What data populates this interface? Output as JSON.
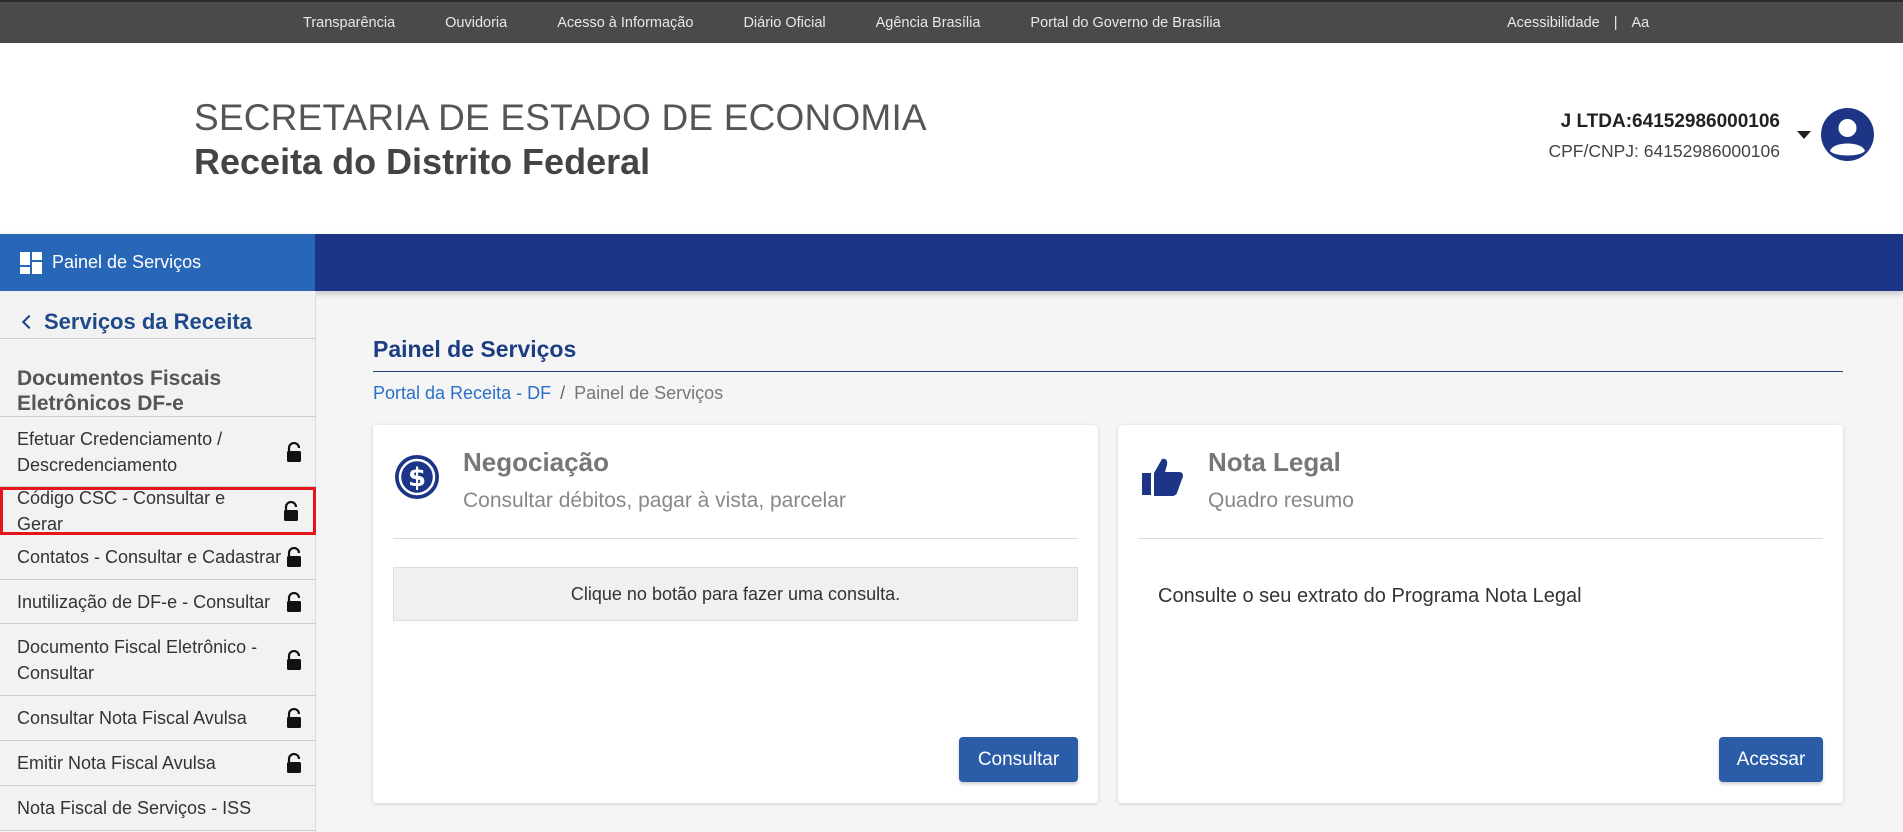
{
  "topbar": {
    "links": [
      "Transparência",
      "Ouvidoria",
      "Acesso à Informação",
      "Diário Oficial",
      "Agência Brasília",
      "Portal do Governo de Brasília"
    ],
    "accessibility": "Acessibilidade",
    "separator": "|",
    "font_size": "Aa"
  },
  "header": {
    "title_line1": "SECRETARIA DE ESTADO DE ECONOMIA",
    "title_line2": "Receita do Distrito Federal",
    "user_name": "J LTDA:64152986000106",
    "user_doc": "CPF/CNPJ: 64152986000106",
    "avatar_icon": "user-circle-icon",
    "menu_icon": "caret-down-icon"
  },
  "nav": {
    "tab_label": "Painel de Serviços",
    "tab_icon": "dashboard-grid-icon"
  },
  "sidebar": {
    "back_label": "Serviços da Receita",
    "section_title": "Documentos Fiscais Eletrônicos DF-e",
    "items": [
      {
        "label": "Efetuar Credenciamento / Descredenciamento",
        "icon": "unlock-icon"
      },
      {
        "label": "Código CSC - Consultar e Gerar",
        "icon": "unlock-icon"
      },
      {
        "label": "Contatos - Consultar e Cadastrar",
        "icon": "unlock-icon"
      },
      {
        "label": "Inutilização de DF-e - Consultar",
        "icon": "unlock-icon"
      },
      {
        "label": "Documento Fiscal Eletrônico - Consultar",
        "icon": "unlock-icon"
      },
      {
        "label": "Consultar Nota Fiscal Avulsa",
        "icon": "unlock-icon"
      },
      {
        "label": "Emitir Nota Fiscal Avulsa",
        "icon": "unlock-icon"
      },
      {
        "label": "Nota Fiscal de Serviços - ISS",
        "icon": ""
      }
    ]
  },
  "main": {
    "title": "Painel de Serviços",
    "breadcrumb": [
      "Portal da Receita - DF",
      "/",
      "Painel de Serviços"
    ],
    "cards": [
      {
        "title": "Negociação",
        "subtitle": "Consultar débitos, pagar à vista, parcelar",
        "message": "Clique no botão para fazer uma consulta.",
        "button": "Consultar",
        "icon": "dollar-circle-icon"
      },
      {
        "title": "Nota Legal",
        "subtitle": "Quadro resumo",
        "message": "Consulte o seu extrato do Programa Nota Legal",
        "button": "Acessar",
        "icon": "thumbs-up-icon"
      }
    ]
  },
  "colors": {
    "topbar": "#4a4a4a",
    "nav_band": "#1c3586",
    "nav_tab": "#2866b8",
    "accent_title": "#1b3d82",
    "button": "#2a5ca8",
    "highlight_border": "#e4161b"
  }
}
